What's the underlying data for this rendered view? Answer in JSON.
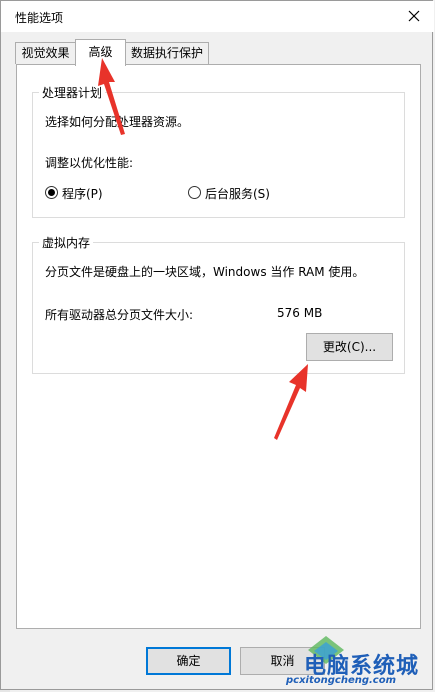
{
  "window": {
    "title": "性能选项"
  },
  "tabs": [
    {
      "label": "视觉效果"
    },
    {
      "label": "高级"
    },
    {
      "label": "数据执行保护"
    }
  ],
  "processor": {
    "group_title": "处理器计划",
    "description": "选择如何分配处理器资源。",
    "adjust_label": "调整以优化性能:",
    "options": [
      {
        "label": "程序(P)",
        "selected": true
      },
      {
        "label": "后台服务(S)",
        "selected": false
      }
    ]
  },
  "virtual_memory": {
    "group_title": "虚拟内存",
    "description": "分页文件是硬盘上的一块区域，Windows 当作 RAM 使用。",
    "total_label": "所有驱动器总分页文件大小:",
    "total_value": "576 MB",
    "change_button": "更改(C)..."
  },
  "footer": {
    "ok_button": "确定",
    "cancel_button": "取消"
  },
  "watermark": {
    "brand": "电脑系统城",
    "url": "pcxitongcheng.com"
  },
  "colors": {
    "annotation_arrow": "#e8332a",
    "focus_border": "#0078d7",
    "watermark": "#1f5fb8"
  }
}
